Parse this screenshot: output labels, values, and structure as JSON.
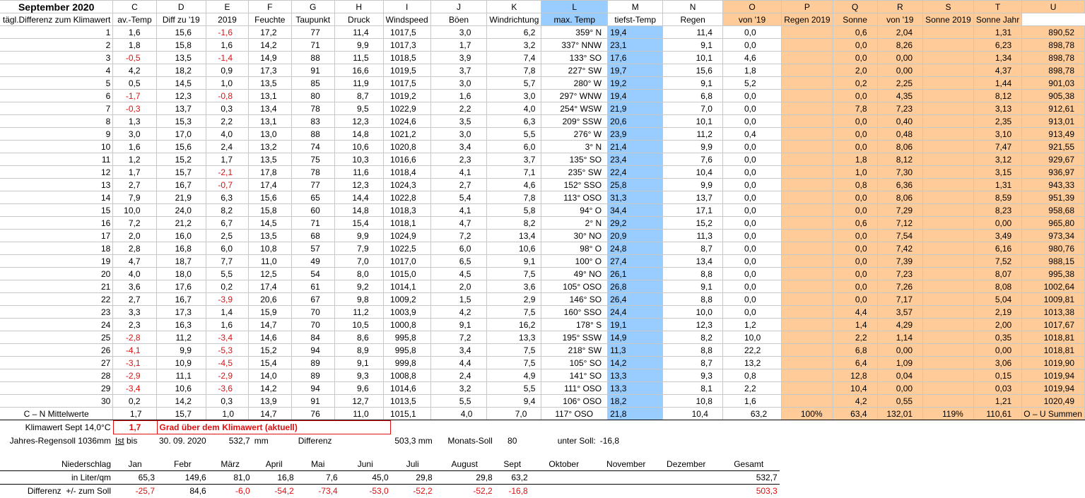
{
  "title": "September 2020",
  "letters": [
    "C",
    "D",
    "E",
    "F",
    "G",
    "H",
    "I",
    "J",
    "K",
    "L",
    "M",
    "N",
    "O",
    "P",
    "Q",
    "R",
    "S",
    "T",
    "U"
  ],
  "headers": [
    "tägl.Differenz zum Klimawert",
    "av.-Temp",
    "Diff zu '19",
    "2019",
    "Feuchte",
    "Taupunkt",
    "Druck",
    "Windspeed",
    "Böen",
    "Windrichtung",
    "max. Temp",
    "tiefst-Temp",
    "Regen",
    "von '19",
    "Regen 2019",
    "Sonne",
    "von '19",
    "Sonne 2019",
    "Sonne Jahr"
  ],
  "rows": [
    [
      "1",
      "1,6",
      "15,6",
      "-1,6",
      "17,2",
      "77",
      "11,4",
      "1017,5",
      "3,0",
      "6,2",
      "359° N",
      "19,4",
      "11,4",
      "0,0",
      "",
      "0,6",
      "2,04",
      "",
      "1,31",
      "890,52"
    ],
    [
      "2",
      "1,8",
      "15,8",
      "1,6",
      "14,2",
      "71",
      "9,9",
      "1017,3",
      "1,7",
      "3,2",
      "337° NNW",
      "23,1",
      "9,1",
      "0,0",
      "",
      "0,0",
      "8,26",
      "",
      "6,23",
      "898,78"
    ],
    [
      "3",
      "-0,5",
      "13,5",
      "-1,4",
      "14,9",
      "88",
      "11,5",
      "1018,5",
      "3,9",
      "7,4",
      "133° SO",
      "17,6",
      "10,1",
      "4,6",
      "",
      "0,0",
      "0,00",
      "",
      "1,34",
      "898,78"
    ],
    [
      "4",
      "4,2",
      "18,2",
      "0,9",
      "17,3",
      "91",
      "16,6",
      "1019,5",
      "3,7",
      "7,8",
      "227° SW",
      "19,7",
      "15,6",
      "1,8",
      "",
      "2,0",
      "0,00",
      "",
      "4,37",
      "898,78"
    ],
    [
      "5",
      "0,5",
      "14,5",
      "1,0",
      "13,5",
      "85",
      "11,9",
      "1017,5",
      "3,0",
      "5,7",
      "280° W",
      "19,2",
      "9,1",
      "5,2",
      "",
      "0,2",
      "2,25",
      "",
      "1,44",
      "901,03"
    ],
    [
      "6",
      "-1,7",
      "12,3",
      "-0,8",
      "13,1",
      "80",
      "8,7",
      "1019,2",
      "1,6",
      "3,0",
      "297° WNW",
      "19,4",
      "6,8",
      "0,0",
      "",
      "0,0",
      "4,35",
      "",
      "8,12",
      "905,38"
    ],
    [
      "7",
      "-0,3",
      "13,7",
      "0,3",
      "13,4",
      "78",
      "9,5",
      "1022,9",
      "2,2",
      "4,0",
      "254° WSW",
      "21,9",
      "7,0",
      "0,0",
      "",
      "7,8",
      "7,23",
      "",
      "3,13",
      "912,61"
    ],
    [
      "8",
      "1,3",
      "15,3",
      "2,2",
      "13,1",
      "83",
      "12,3",
      "1024,6",
      "3,5",
      "6,3",
      "209° SSW",
      "20,6",
      "10,1",
      "0,0",
      "",
      "0,0",
      "0,40",
      "",
      "2,35",
      "913,01"
    ],
    [
      "9",
      "3,0",
      "17,0",
      "4,0",
      "13,0",
      "88",
      "14,8",
      "1021,2",
      "3,0",
      "5,5",
      "276° W",
      "23,9",
      "11,2",
      "0,4",
      "",
      "0,0",
      "0,48",
      "",
      "3,10",
      "913,49"
    ],
    [
      "10",
      "1,6",
      "15,6",
      "2,4",
      "13,2",
      "74",
      "10,6",
      "1020,8",
      "3,4",
      "6,0",
      "3° N",
      "21,4",
      "9,9",
      "0,0",
      "",
      "0,0",
      "8,06",
      "",
      "7,47",
      "921,55"
    ],
    [
      "11",
      "1,2",
      "15,2",
      "1,7",
      "13,5",
      "75",
      "10,3",
      "1016,6",
      "2,3",
      "3,7",
      "135° SO",
      "23,4",
      "7,6",
      "0,0",
      "",
      "1,8",
      "8,12",
      "",
      "3,12",
      "929,67"
    ],
    [
      "12",
      "1,7",
      "15,7",
      "-2,1",
      "17,8",
      "78",
      "11,6",
      "1018,4",
      "4,1",
      "7,1",
      "235° SW",
      "22,4",
      "10,4",
      "0,0",
      "",
      "1,0",
      "7,30",
      "",
      "3,15",
      "936,97"
    ],
    [
      "13",
      "2,7",
      "16,7",
      "-0,7",
      "17,4",
      "77",
      "12,3",
      "1024,3",
      "2,7",
      "4,6",
      "152° SSO",
      "25,8",
      "9,9",
      "0,0",
      "",
      "0,8",
      "6,36",
      "",
      "1,31",
      "943,33"
    ],
    [
      "14",
      "7,9",
      "21,9",
      "6,3",
      "15,6",
      "65",
      "14,4",
      "1022,8",
      "5,4",
      "7,8",
      "113° OSO",
      "31,3",
      "13,7",
      "0,0",
      "",
      "0,0",
      "8,06",
      "",
      "8,59",
      "951,39"
    ],
    [
      "15",
      "10,0",
      "24,0",
      "8,2",
      "15,8",
      "60",
      "14,8",
      "1018,3",
      "4,1",
      "5,8",
      "94° O",
      "34,4",
      "17,1",
      "0,0",
      "",
      "0,0",
      "7,29",
      "",
      "8,23",
      "958,68"
    ],
    [
      "16",
      "7,2",
      "21,2",
      "6,7",
      "14,5",
      "71",
      "15,4",
      "1018,1",
      "4,7",
      "8,2",
      "2° N",
      "29,2",
      "15,2",
      "0,0",
      "",
      "0,6",
      "7,12",
      "",
      "0,00",
      "965,80"
    ],
    [
      "17",
      "2,0",
      "16,0",
      "2,5",
      "13,5",
      "68",
      "9,9",
      "1024,9",
      "7,2",
      "13,4",
      "30° NO",
      "20,9",
      "11,3",
      "0,0",
      "",
      "0,0",
      "7,54",
      "",
      "3,49",
      "973,34"
    ],
    [
      "18",
      "2,8",
      "16,8",
      "6,0",
      "10,8",
      "57",
      "7,9",
      "1022,5",
      "6,0",
      "10,6",
      "98° O",
      "24,8",
      "8,7",
      "0,0",
      "",
      "0,0",
      "7,42",
      "",
      "6,16",
      "980,76"
    ],
    [
      "19",
      "4,7",
      "18,7",
      "7,7",
      "11,0",
      "49",
      "7,0",
      "1017,0",
      "6,5",
      "9,1",
      "100° O",
      "27,4",
      "13,4",
      "0,0",
      "",
      "0,0",
      "7,39",
      "",
      "7,52",
      "988,15"
    ],
    [
      "20",
      "4,0",
      "18,0",
      "5,5",
      "12,5",
      "54",
      "8,0",
      "1015,0",
      "4,5",
      "7,5",
      "49° NO",
      "26,1",
      "8,8",
      "0,0",
      "",
      "0,0",
      "7,23",
      "",
      "8,07",
      "995,38"
    ],
    [
      "21",
      "3,6",
      "17,6",
      "0,2",
      "17,4",
      "61",
      "9,2",
      "1014,1",
      "2,0",
      "3,6",
      "105° OSO",
      "26,8",
      "9,1",
      "0,0",
      "",
      "0,0",
      "7,26",
      "",
      "8,08",
      "1002,64"
    ],
    [
      "22",
      "2,7",
      "16,7",
      "-3,9",
      "20,6",
      "67",
      "9,8",
      "1009,2",
      "1,5",
      "2,9",
      "146° SO",
      "26,4",
      "8,8",
      "0,0",
      "",
      "0,0",
      "7,17",
      "",
      "5,04",
      "1009,81"
    ],
    [
      "23",
      "3,3",
      "17,3",
      "1,4",
      "15,9",
      "70",
      "11,2",
      "1003,9",
      "4,2",
      "7,5",
      "160° SSO",
      "24,4",
      "10,0",
      "0,0",
      "",
      "4,4",
      "3,57",
      "",
      "2,19",
      "1013,38"
    ],
    [
      "24",
      "2,3",
      "16,3",
      "1,6",
      "14,7",
      "70",
      "10,5",
      "1000,8",
      "9,1",
      "16,2",
      "178° S",
      "19,1",
      "12,3",
      "1,2",
      "",
      "1,4",
      "4,29",
      "",
      "2,00",
      "1017,67"
    ],
    [
      "25",
      "-2,8",
      "11,2",
      "-3,4",
      "14,6",
      "84",
      "8,6",
      "995,8",
      "7,2",
      "13,3",
      "195° SSW",
      "14,9",
      "8,2",
      "10,0",
      "",
      "2,2",
      "1,14",
      "",
      "0,35",
      "1018,81"
    ],
    [
      "26",
      "-4,1",
      "9,9",
      "-5,3",
      "15,2",
      "94",
      "8,9",
      "995,8",
      "3,4",
      "7,5",
      "218° SW",
      "11,3",
      "8,8",
      "22,2",
      "",
      "6,8",
      "0,00",
      "",
      "0,00",
      "1018,81"
    ],
    [
      "27",
      "-3,1",
      "10,9",
      "-4,5",
      "15,4",
      "89",
      "9,1",
      "999,8",
      "4,4",
      "7,5",
      "105° SO",
      "14,2",
      "8,7",
      "13,2",
      "",
      "6,4",
      "1,09",
      "",
      "3,06",
      "1019,90"
    ],
    [
      "28",
      "-2,9",
      "11,1",
      "-2,9",
      "14,0",
      "89",
      "9,3",
      "1008,8",
      "2,4",
      "4,9",
      "141° SO",
      "13,3",
      "9,3",
      "0,8",
      "",
      "12,8",
      "0,04",
      "",
      "0,15",
      "1019,94"
    ],
    [
      "29",
      "-3,4",
      "10,6",
      "-3,6",
      "14,2",
      "94",
      "9,6",
      "1014,6",
      "3,2",
      "5,5",
      "111° OSO",
      "13,3",
      "8,1",
      "2,2",
      "",
      "10,4",
      "0,00",
      "",
      "0,03",
      "1019,94"
    ],
    [
      "30",
      "0,2",
      "14,2",
      "0,3",
      "13,9",
      "91",
      "12,7",
      "1013,5",
      "5,5",
      "9,4",
      "106° OSO",
      "18,2",
      "10,8",
      "1,6",
      "",
      "4,2",
      "0,55",
      "",
      "1,21",
      "1020,49"
    ]
  ],
  "averages": [
    "C – N Mittelwerte",
    "1,7",
    "15,7",
    "1,0",
    "14,7",
    "76",
    "11,0",
    "1015,1",
    "4,0",
    "7,0",
    "117° OSO",
    "21,8",
    "10,4",
    "63,2",
    "100%",
    "63,4",
    "132,01",
    "119%",
    "110,61",
    "O – U Summen"
  ],
  "klima": {
    "label": "Klimawert Sept 14,0°C",
    "value": "1,7",
    "text": "Grad über dem Klimawert (aktuell)"
  },
  "regen": {
    "label": "Jahres-Regensoll 1036mm",
    "ist_prefix": "Ist",
    "ist_bis": " bis",
    "date": "30. 09. 2020",
    "ist_value": "532,7",
    "unit": "mm",
    "diff_label": "Differenz",
    "diff_value": "503,3 mm",
    "monats_label": "Monats-Soll",
    "monats_value": "80",
    "unter_label": "unter Soll:",
    "unter_value": "-16,8"
  },
  "months": {
    "label": "Niederschlag",
    "sub1": "in Liter/qm",
    "sub2": "Differenz  +/- zum Soll",
    "names": [
      "Jan",
      "Febr",
      "März",
      "April",
      "Mai",
      "Juni",
      "Juli",
      "August",
      "Sept",
      "Oktober",
      "November",
      "Dezember",
      "Gesamt"
    ],
    "values": [
      "65,3",
      "149,6",
      "81,0",
      "16,8",
      "7,6",
      "45,0",
      "29,8",
      "29,8",
      "63,2",
      "",
      "",
      "",
      "532,7"
    ],
    "diffs": [
      "-25,7",
      "84,6",
      "-6,0",
      "-54,2",
      "-73,4",
      "-53,0",
      "-52,2",
      "-52,2",
      "-16,8",
      "",
      "",
      "",
      "503,3"
    ]
  }
}
